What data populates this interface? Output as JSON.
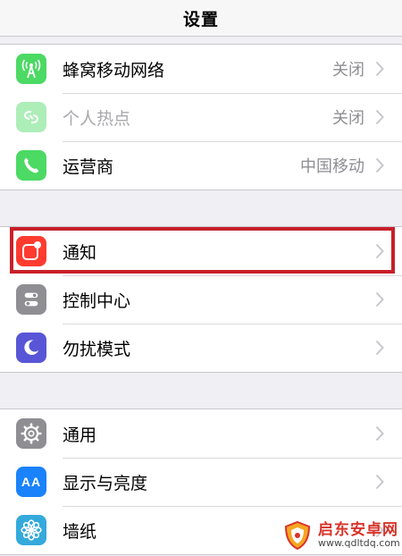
{
  "header": {
    "title": "设置"
  },
  "colors": {
    "accent_highlight": "#c8202a",
    "cellular": "#4cd964",
    "notifications": "#ff3b30",
    "control_center": "#8e8e93",
    "dnd": "#5856d6",
    "display": "#1a82fb",
    "wallpaper": "#34aadc"
  },
  "groups": [
    {
      "items": [
        {
          "icon": "cellular-antenna-icon",
          "label": "蜂窝移动网络",
          "value": "关闭"
        },
        {
          "icon": "personal-hotspot-icon",
          "label": "个人热点",
          "value": "关闭",
          "disabled": true
        },
        {
          "icon": "phone-icon",
          "label": "运营商",
          "value": "中国移动"
        }
      ]
    },
    {
      "items": [
        {
          "icon": "notifications-icon",
          "label": "通知",
          "highlighted": true
        },
        {
          "icon": "control-center-icon",
          "label": "控制中心"
        },
        {
          "icon": "moon-icon",
          "label": "勿扰模式"
        }
      ]
    },
    {
      "items": [
        {
          "icon": "gear-icon",
          "label": "通用"
        },
        {
          "icon": "text-size-icon",
          "icon_text": "AA",
          "label": "显示与亮度"
        },
        {
          "icon": "flower-icon",
          "label": "墙纸"
        }
      ]
    }
  ],
  "watermark": {
    "name": "启东安卓网",
    "url": "www.qdltdq.com"
  }
}
